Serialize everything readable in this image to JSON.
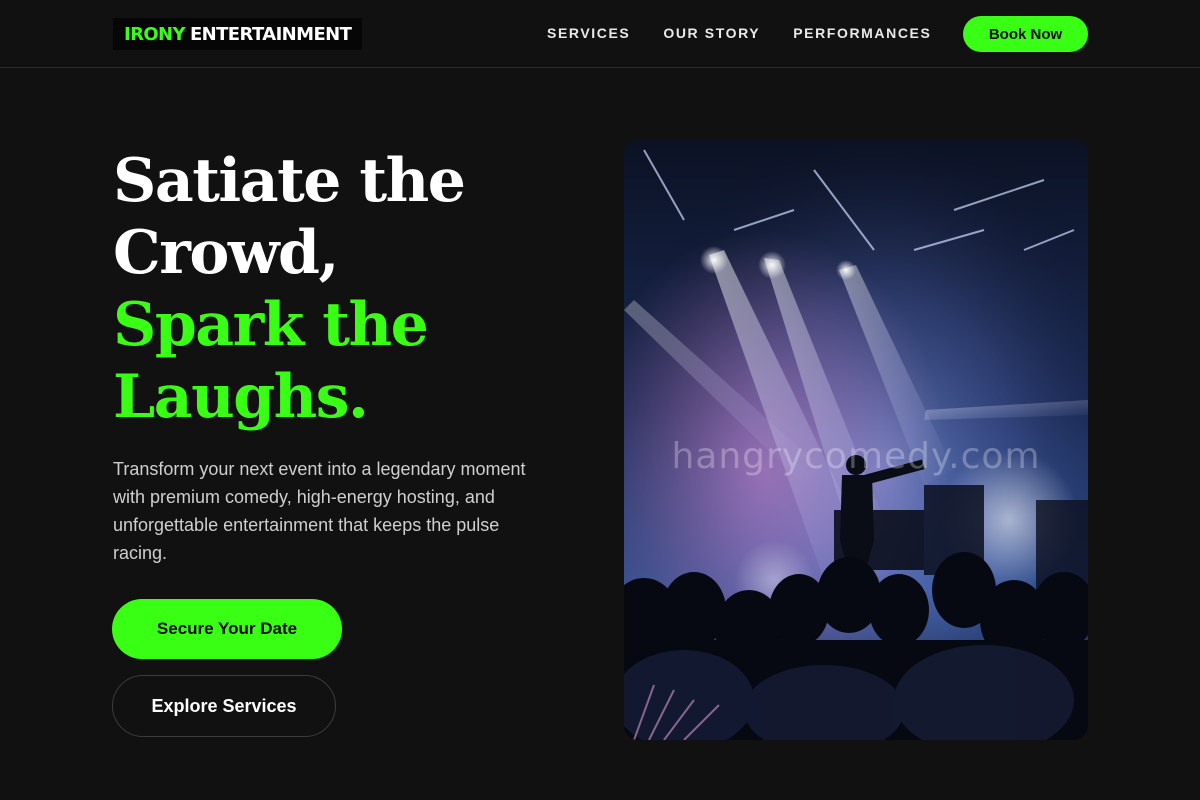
{
  "brand": {
    "accent_word": "IRONY",
    "rest_word": "ENTERTAINMENT",
    "accent_color": "#39ff14"
  },
  "nav": {
    "links": [
      "SERVICES",
      "OUR STORY",
      "PERFORMANCES"
    ],
    "cta_label": "Book Now"
  },
  "hero": {
    "headline_white": [
      "Satiate the",
      "Crowd,"
    ],
    "headline_green": [
      "Spark the",
      "Laughs."
    ],
    "subtitle": "Transform your next event into a legendary moment with premium comedy, high-energy hosting, and unforgettable entertainment that keeps the pulse racing.",
    "primary_button": "Secure Your Date",
    "secondary_button": "Explore Services",
    "image_watermark": "hangrycomedy.com"
  },
  "colors": {
    "background": "#111111",
    "accent": "#39ff14",
    "text": "#ffffff",
    "muted_text": "#cfcfcf"
  }
}
